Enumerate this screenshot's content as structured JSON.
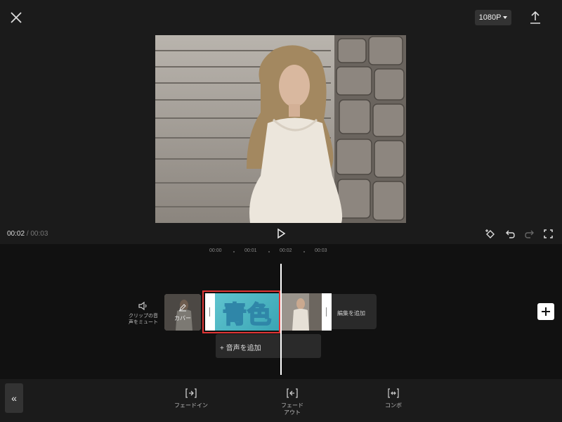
{
  "header": {
    "resolution": "1080P",
    "icons": {
      "close": "close-icon",
      "export": "upload-icon"
    }
  },
  "player": {
    "current_time": "00:02",
    "separator": "/",
    "total_time": "00:03"
  },
  "ruler": {
    "ticks": [
      "00:00",
      "00:01",
      "00:02",
      "00:03"
    ]
  },
  "timeline": {
    "mute_label": "クリップの音声をミュート",
    "cover_label": "カバー",
    "clip_text": "青色",
    "add_edit_label": "編集を追加",
    "add_audio_label": "+ 音声を追加"
  },
  "toolbar": {
    "collapse_glyph": "«",
    "tools": [
      {
        "label": "フェードイン"
      },
      {
        "label": "フェードアウト"
      },
      {
        "label": "コンボ"
      }
    ]
  },
  "colors": {
    "selection": "#e03535",
    "clip_blue": "#4fb6c4"
  }
}
